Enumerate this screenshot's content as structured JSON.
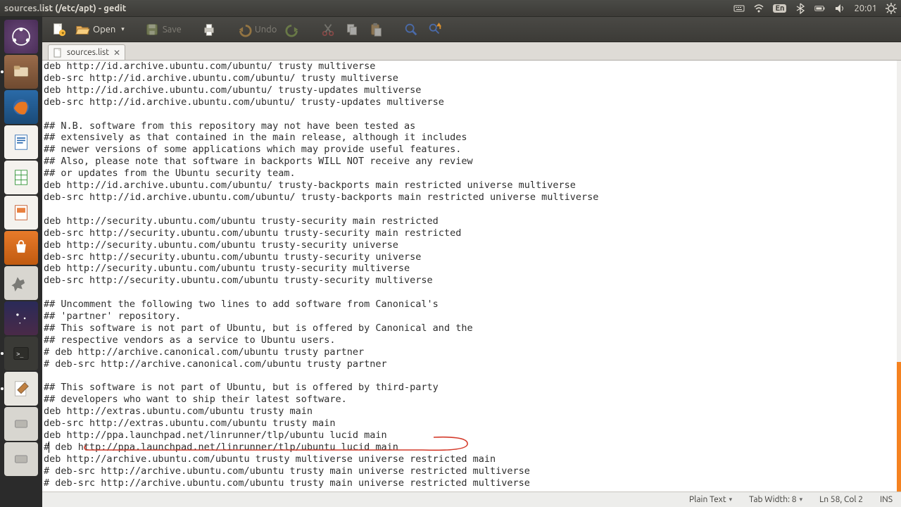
{
  "window": {
    "title": "sources.list (/etc/apt) - gedit"
  },
  "panel": {
    "lang": "En",
    "time": "20:01"
  },
  "toolbar": {
    "open": "Open",
    "save": "Save",
    "undo": "Undo"
  },
  "tab": {
    "name": "sources.list"
  },
  "editor": {
    "lines": [
      "deb http://id.archive.ubuntu.com/ubuntu/ trusty multiverse",
      "deb-src http://id.archive.ubuntu.com/ubuntu/ trusty multiverse",
      "deb http://id.archive.ubuntu.com/ubuntu/ trusty-updates multiverse",
      "deb-src http://id.archive.ubuntu.com/ubuntu/ trusty-updates multiverse",
      "",
      "## N.B. software from this repository may not have been tested as",
      "## extensively as that contained in the main release, although it includes",
      "## newer versions of some applications which may provide useful features.",
      "## Also, please note that software in backports WILL NOT receive any review",
      "## or updates from the Ubuntu security team.",
      "deb http://id.archive.ubuntu.com/ubuntu/ trusty-backports main restricted universe multiverse",
      "deb-src http://id.archive.ubuntu.com/ubuntu/ trusty-backports main restricted universe multiverse",
      "",
      "deb http://security.ubuntu.com/ubuntu trusty-security main restricted",
      "deb-src http://security.ubuntu.com/ubuntu trusty-security main restricted",
      "deb http://security.ubuntu.com/ubuntu trusty-security universe",
      "deb-src http://security.ubuntu.com/ubuntu trusty-security universe",
      "deb http://security.ubuntu.com/ubuntu trusty-security multiverse",
      "deb-src http://security.ubuntu.com/ubuntu trusty-security multiverse",
      "",
      "## Uncomment the following two lines to add software from Canonical's",
      "## 'partner' repository.",
      "## This software is not part of Ubuntu, but is offered by Canonical and the",
      "## respective vendors as a service to Ubuntu users.",
      "# deb http://archive.canonical.com/ubuntu trusty partner",
      "# deb-src http://archive.canonical.com/ubuntu trusty partner",
      "",
      "## This software is not part of Ubuntu, but is offered by third-party",
      "## developers who want to ship their latest software.",
      "deb http://extras.ubuntu.com/ubuntu trusty main",
      "deb-src http://extras.ubuntu.com/ubuntu trusty main",
      "deb http://ppa.launchpad.net/linrunner/tlp/ubuntu lucid main",
      "# deb http://ppa.launchpad.net/linrunner/tlp/ubuntu lucid main",
      "deb http://archive.ubuntu.com/ubuntu trusty multiverse universe restricted main",
      "# deb-src http://archive.ubuntu.com/ubuntu trusty main universe restricted multiverse",
      "# deb-src http://archive.ubuntu.com/ubuntu trusty main universe restricted multiverse"
    ],
    "highlight_line_index": 32
  },
  "status": {
    "syntax": "Plain Text",
    "tabwidth": "Tab Width: 8",
    "position": "Ln 58, Col 2",
    "insert": "INS"
  },
  "launcher": {
    "items": [
      "ubuntu-dash",
      "files",
      "firefox",
      "writer",
      "calc",
      "impress",
      "software-center",
      "settings",
      "stellarium",
      "terminal",
      "gedit",
      "disk",
      "mount"
    ]
  }
}
